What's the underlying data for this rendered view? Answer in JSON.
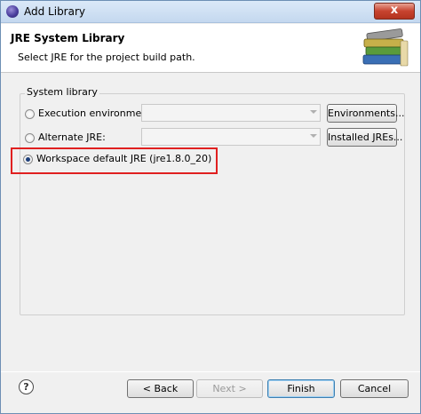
{
  "window": {
    "title": "Add Library",
    "close_glyph": "x"
  },
  "header": {
    "title": "JRE System Library",
    "description": "Select JRE for the project build path."
  },
  "group": {
    "label": "System library",
    "options": [
      {
        "label": "Execution environment:",
        "checked": false,
        "combo_value": "",
        "button": "Environments..."
      },
      {
        "label": "Alternate JRE:",
        "checked": false,
        "combo_value": "",
        "button": "Installed JREs..."
      },
      {
        "label": "Workspace default JRE (jre1.8.0_20)",
        "checked": true
      }
    ]
  },
  "footer": {
    "help_glyph": "?",
    "back": "< Back",
    "next": "Next >",
    "finish": "Finish",
    "cancel": "Cancel"
  },
  "colors": {
    "highlight_box": "#e02020",
    "accent": "#1e3f7a"
  },
  "icons": [
    "app-icon",
    "library-books-icon",
    "help-icon",
    "close-icon"
  ]
}
